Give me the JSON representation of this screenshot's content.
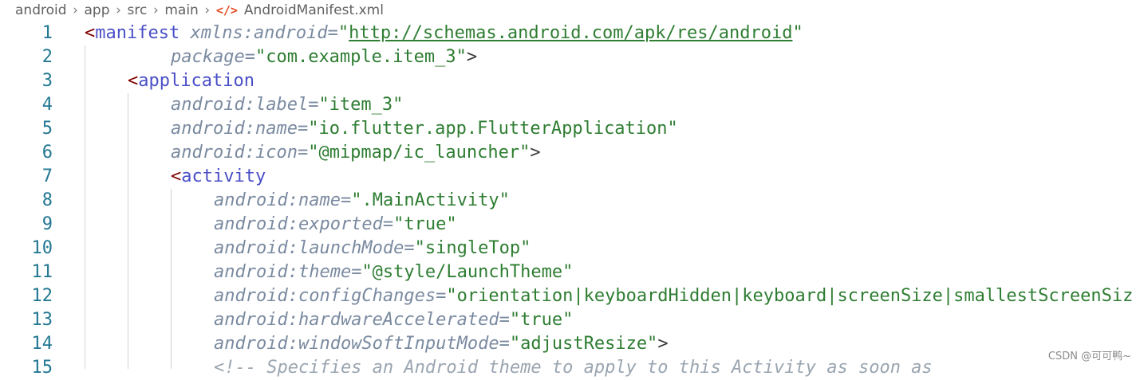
{
  "breadcrumb": {
    "items": [
      "android",
      "app",
      "src",
      "main"
    ],
    "file_icon": "</>",
    "file": "AndroidManifest.xml"
  },
  "lines": [
    {
      "n": "1",
      "indent": 0,
      "tokens": [
        {
          "t": "punct",
          "v": "<"
        },
        {
          "t": "tag",
          "v": "manifest"
        },
        {
          "t": "text",
          "v": " "
        },
        {
          "t": "attr",
          "v": "xmlns:android"
        },
        {
          "t": "eq",
          "v": "="
        },
        {
          "t": "quote",
          "v": "\""
        },
        {
          "t": "url",
          "v": "http://schemas.android.com/apk/res/android"
        },
        {
          "t": "quote",
          "v": "\""
        }
      ]
    },
    {
      "n": "2",
      "indent": 2,
      "tokens": [
        {
          "t": "attr",
          "v": "package"
        },
        {
          "t": "eq",
          "v": "="
        },
        {
          "t": "val",
          "v": "\"com.example.item_3\""
        },
        {
          "t": "text",
          "v": ">"
        }
      ]
    },
    {
      "n": "3",
      "indent": 1,
      "tokens": [
        {
          "t": "punct",
          "v": "<"
        },
        {
          "t": "tag",
          "v": "application"
        }
      ]
    },
    {
      "n": "4",
      "indent": 2,
      "tokens": [
        {
          "t": "attr",
          "v": "android:label"
        },
        {
          "t": "eq",
          "v": "="
        },
        {
          "t": "val",
          "v": "\"item_3\""
        }
      ]
    },
    {
      "n": "5",
      "indent": 2,
      "tokens": [
        {
          "t": "attr",
          "v": "android:name"
        },
        {
          "t": "eq",
          "v": "="
        },
        {
          "t": "val",
          "v": "\"io.flutter.app.FlutterApplication\""
        }
      ]
    },
    {
      "n": "6",
      "indent": 2,
      "tokens": [
        {
          "t": "attr",
          "v": "android:icon"
        },
        {
          "t": "eq",
          "v": "="
        },
        {
          "t": "val",
          "v": "\"@mipmap/ic_launcher\""
        },
        {
          "t": "text",
          "v": ">"
        }
      ]
    },
    {
      "n": "7",
      "indent": 2,
      "tokens": [
        {
          "t": "punct",
          "v": "<"
        },
        {
          "t": "tag",
          "v": "activity"
        }
      ]
    },
    {
      "n": "8",
      "indent": 3,
      "tokens": [
        {
          "t": "attr",
          "v": "android:name"
        },
        {
          "t": "eq",
          "v": "="
        },
        {
          "t": "val",
          "v": "\".MainActivity\""
        }
      ]
    },
    {
      "n": "9",
      "indent": 3,
      "tokens": [
        {
          "t": "attr",
          "v": "android:exported"
        },
        {
          "t": "eq",
          "v": "="
        },
        {
          "t": "val",
          "v": "\"true\""
        }
      ]
    },
    {
      "n": "10",
      "indent": 3,
      "tokens": [
        {
          "t": "attr",
          "v": "android:launchMode"
        },
        {
          "t": "eq",
          "v": "="
        },
        {
          "t": "val",
          "v": "\"singleTop\""
        }
      ]
    },
    {
      "n": "11",
      "indent": 3,
      "tokens": [
        {
          "t": "attr",
          "v": "android:theme"
        },
        {
          "t": "eq",
          "v": "="
        },
        {
          "t": "val",
          "v": "\"@style/LaunchTheme\""
        }
      ]
    },
    {
      "n": "12",
      "indent": 3,
      "tokens": [
        {
          "t": "attr",
          "v": "android:configChanges"
        },
        {
          "t": "eq",
          "v": "="
        },
        {
          "t": "val",
          "v": "\"orientation|keyboardHidden|keyboard|screenSize|smallestScreenSiz"
        }
      ]
    },
    {
      "n": "13",
      "indent": 3,
      "tokens": [
        {
          "t": "attr",
          "v": "android:hardwareAccelerated"
        },
        {
          "t": "eq",
          "v": "="
        },
        {
          "t": "val",
          "v": "\"true\""
        }
      ]
    },
    {
      "n": "14",
      "indent": 3,
      "tokens": [
        {
          "t": "attr",
          "v": "android:windowSoftInputMode"
        },
        {
          "t": "eq",
          "v": "="
        },
        {
          "t": "val",
          "v": "\"adjustResize\""
        },
        {
          "t": "text",
          "v": ">"
        }
      ]
    },
    {
      "n": "15",
      "indent": 3,
      "tokens": [
        {
          "t": "comment",
          "v": "<!-- Specifies an Android theme to apply to this Activity as soon as"
        }
      ]
    }
  ],
  "watermark": "CSDN @可可鸭~"
}
